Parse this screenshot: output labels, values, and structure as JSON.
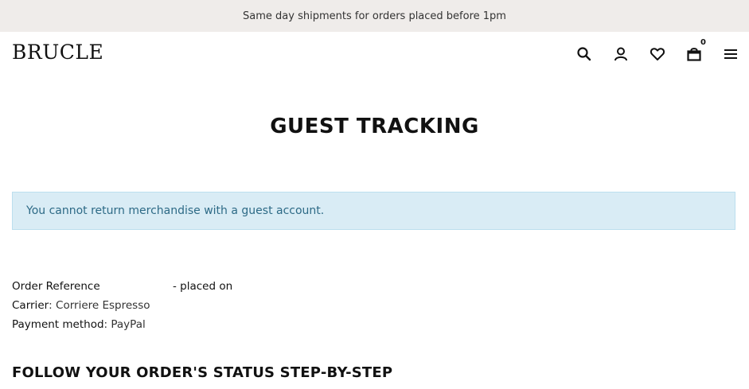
{
  "topbar": {
    "message": "Same day shipments for orders placed before 1pm"
  },
  "header": {
    "logo": "BRUCLE",
    "icons": [
      "search-icon",
      "user-icon",
      "heart-icon",
      "bag-icon",
      "menu-icon"
    ],
    "cart_count": "0"
  },
  "page": {
    "title": "GUEST TRACKING"
  },
  "alert": {
    "text": "You cannot return merchandise with a guest account."
  },
  "order": {
    "reference_label": "Order Reference",
    "placed_on": "- placed on",
    "carrier_label": "Carrier",
    "carrier_value": "Corriere Espresso",
    "payment_label": "Payment method",
    "payment_value": "PayPal"
  },
  "status_section": {
    "title": "FOLLOW YOUR ORDER'S STATUS STEP-BY-STEP"
  },
  "colors": {
    "topbar_bg": "#efecea",
    "alert_bg": "#d9ecf5",
    "alert_text": "#2d6a86"
  }
}
